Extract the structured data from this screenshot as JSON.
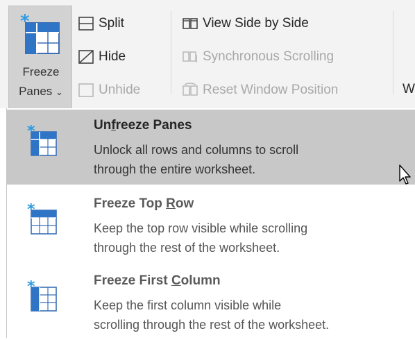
{
  "ribbon": {
    "freeze_panes": {
      "line1": "Freeze",
      "line2": "Panes",
      "caret": "⌄",
      "icon": "freeze-panes-icon"
    },
    "split_label": "Split",
    "hide_label": "Hide",
    "unhide_label": "Unhide",
    "view_side_by_side_label": "View Side by Side",
    "synchronous_scrolling_label": "Synchronous Scrolling",
    "reset_window_position_label": "Reset Window Position",
    "truncated_next": "W"
  },
  "menu": {
    "items": [
      {
        "title_pre": "Un",
        "title_key": "f",
        "title_post": "reeze Panes",
        "desc_line1": "Unlock all rows and columns to scroll",
        "desc_line2": "through the entire worksheet.",
        "highlighted": true,
        "icon": "unfreeze-panes-icon"
      },
      {
        "title_pre": "Freeze Top ",
        "title_key": "R",
        "title_post": "ow",
        "desc_line1": "Keep the top row visible while scrolling",
        "desc_line2": "through the rest of the worksheet.",
        "highlighted": false,
        "icon": "freeze-top-row-icon"
      },
      {
        "title_pre": "Freeze First ",
        "title_key": "C",
        "title_post": "olumn",
        "desc_line1": "Keep the first column visible while",
        "desc_line2": "scrolling through the rest of the worksheet.",
        "highlighted": false,
        "icon": "freeze-first-column-icon"
      }
    ]
  },
  "colors": {
    "accent_blue": "#2e75c8",
    "highlight": "#c8c8c8",
    "ribbon_bg": "#f3f3f3"
  }
}
